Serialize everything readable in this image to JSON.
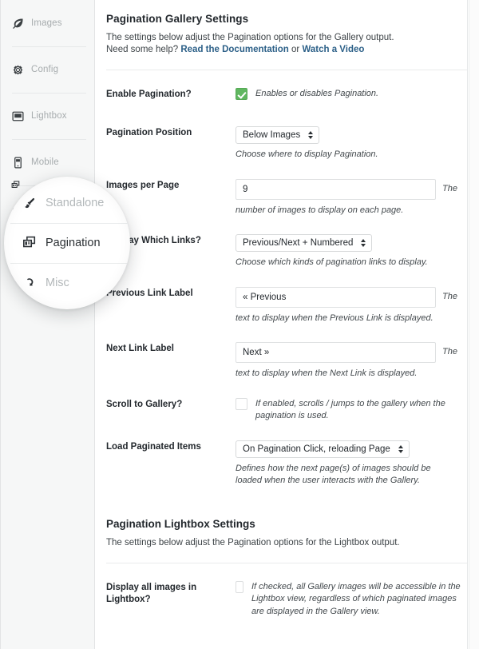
{
  "sidebar": {
    "items": [
      {
        "label": "Images",
        "icon": "leaf-icon"
      },
      {
        "label": "Config",
        "icon": "gear-icon"
      },
      {
        "label": "Lightbox",
        "icon": "monitor-icon"
      },
      {
        "label": "Mobile",
        "icon": "phone-icon"
      },
      {
        "label": "Standalone",
        "icon": "diamond-icon"
      }
    ]
  },
  "magnifier": {
    "items": [
      {
        "label": "Standalone",
        "icon": "brush-icon",
        "active": false
      },
      {
        "label": "Pagination",
        "icon": "pagination-icon",
        "active": true
      },
      {
        "label": "Misc",
        "icon": "misc-icon",
        "active": false
      }
    ]
  },
  "gallery_section": {
    "title": "Pagination Gallery Settings",
    "desc_line1": "The settings below adjust the Pagination options for the Gallery output.",
    "desc_line2_pre": "Need some help? ",
    "link_docs": "Read the Documentation",
    "desc_or": " or ",
    "link_video": "Watch a Video"
  },
  "fields": {
    "enable_pagination": {
      "label": "Enable Pagination?",
      "checked": true,
      "help": "Enables or disables Pagination."
    },
    "pagination_position": {
      "label": "Pagination Position",
      "value": "Below Images",
      "help": "Choose where to display Pagination."
    },
    "images_per_page": {
      "label": "Images per Page",
      "value": "9",
      "help_after": "The",
      "help": "number of images to display on each page."
    },
    "display_which_links": {
      "label": "Display Which Links?",
      "value": "Previous/Next + Numbered",
      "help": "Choose which kinds of pagination links to display."
    },
    "previous_link_label": {
      "label": "Previous Link Label",
      "value": "« Previous",
      "help_after": "The",
      "help": "text to display when the Previous Link is displayed."
    },
    "next_link_label": {
      "label": "Next Link Label",
      "value": "Next »",
      "help_after": "The",
      "help": "text to display when the Next Link is displayed."
    },
    "scroll_to_gallery": {
      "label": "Scroll to Gallery?",
      "checked": false,
      "help": "If enabled, scrolls / jumps to the gallery when the pagination is used."
    },
    "load_paginated_items": {
      "label": "Load Paginated Items",
      "value": "On Pagination Click, reloading Page",
      "help": "Defines how the next page(s) of images should be loaded when the user interacts with the Gallery."
    },
    "display_all_in_lightbox": {
      "label": "Display all images in Lightbox?",
      "checked": false,
      "help": "If checked, all Gallery images will be accessible in the Lightbox view, regardless of which paginated images are displayed in the Gallery view."
    }
  },
  "lightbox_section": {
    "title": "Pagination Lightbox Settings",
    "desc": "The settings below adjust the Pagination options for the Lightbox output."
  },
  "colors": {
    "checkbox_on": "#60b760",
    "link": "#2b5f87",
    "sidebar_bg": "#f6f7f7",
    "text": "#23282d"
  }
}
